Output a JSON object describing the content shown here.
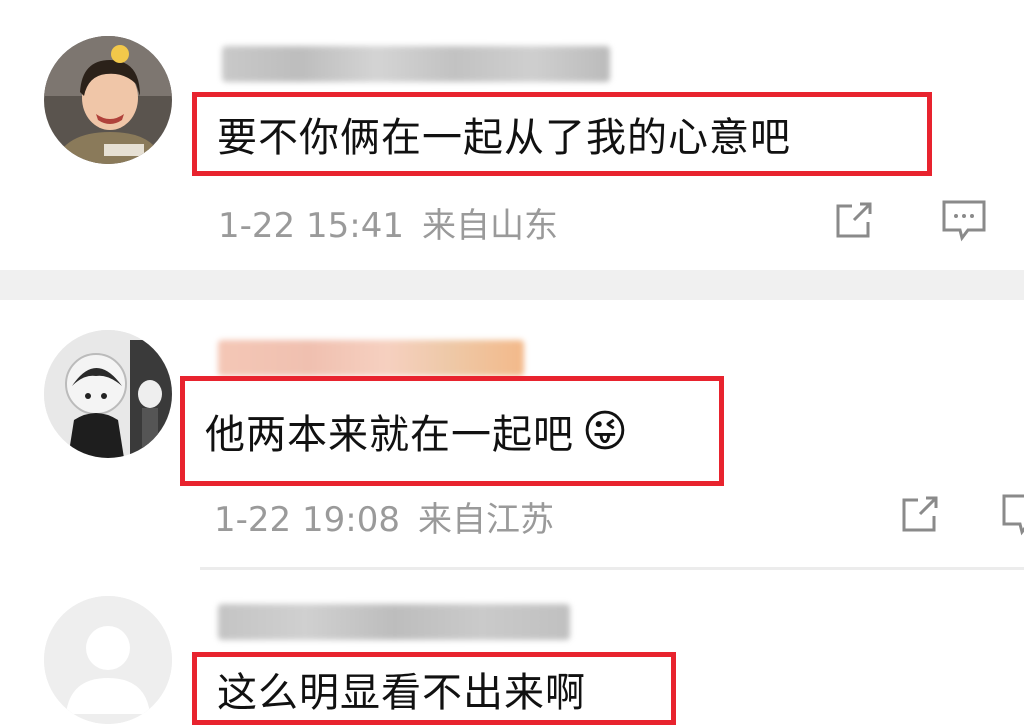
{
  "comments": [
    {
      "text": "要不你俩在一起从了我的心意吧",
      "date": "1-22 15:41",
      "location": "来自山东"
    },
    {
      "text": "他两本来就在一起吧",
      "emoji": "😜",
      "date": "1-22 19:08",
      "location": "来自江苏"
    },
    {
      "text": "这么明显看不出来啊"
    }
  ],
  "icons": {
    "share": "share-icon",
    "reply": "comment-icon"
  },
  "colors": {
    "highlight_box": "#e8232e",
    "meta_text": "#9a9a9a",
    "divider": "#f0f0f0"
  }
}
